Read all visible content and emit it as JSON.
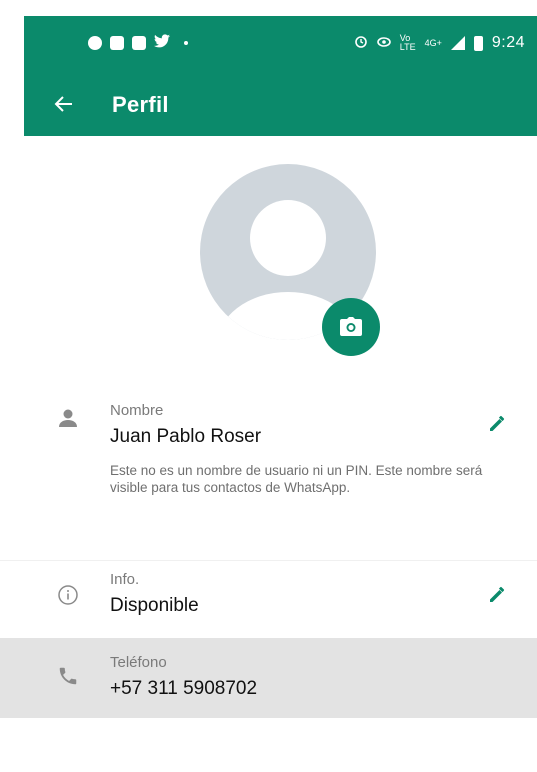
{
  "statusbar": {
    "time": "9:24",
    "network": "4G+",
    "left_icons": [
      "messenger-icon",
      "app-icon",
      "app-icon",
      "twitter-icon",
      "dot-icon"
    ],
    "right_icons": [
      "alarm-icon",
      "eye-icon",
      "volte-icon",
      "signal-icon",
      "battery-icon"
    ]
  },
  "toolbar": {
    "title": "Perfil",
    "back_icon": "arrow-left-icon"
  },
  "colors": {
    "brand": "#0b8a6b",
    "avatar_bg": "#cfd6dc",
    "highlight_row": "#e3e3e3"
  },
  "profile": {
    "name_label": "Nombre",
    "name_value": "Juan Pablo Roser",
    "name_help": "Este no es un nombre de usuario ni un PIN. Este nombre será visible para tus contactos de WhatsApp.",
    "info_label": "Info.",
    "info_value": "Disponible",
    "phone_label": "Teléfono",
    "phone_value": "+57 311 5908702"
  }
}
